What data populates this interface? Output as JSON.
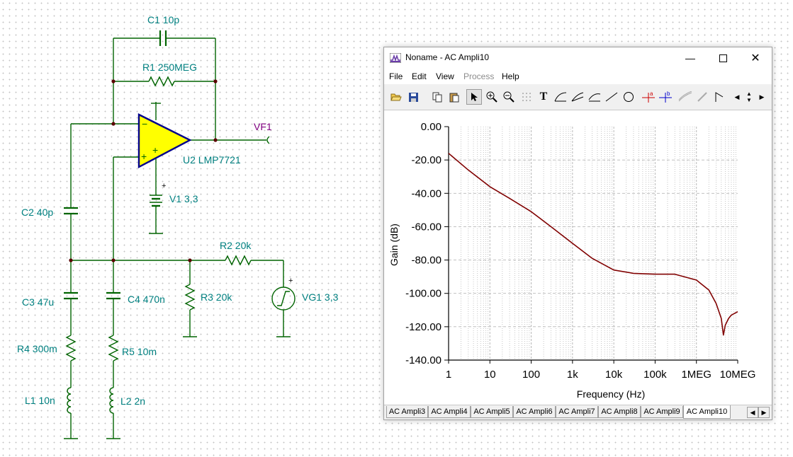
{
  "schematic": {
    "c1": "C1 10p",
    "r1": "R1 250MEG",
    "vf1": "VF1",
    "u2": "U2 LMP7721",
    "v1": "V1 3,3",
    "c2": "C2 40p",
    "r2": "R2 20k",
    "c3": "C3 47u",
    "c4": "C4 470n",
    "r3": "R3 20k",
    "vg1": "VG1 3,3",
    "r4": "R4 300m",
    "r5": "R5 10m",
    "l1": "L1 10n",
    "l2": "L2 2n",
    "wire_color": "#006400",
    "opamp_fill": "#ffff00",
    "opamp_stroke": "#00008b"
  },
  "window": {
    "title": "Noname - AC Ampli10",
    "menu": [
      {
        "label": "File"
      },
      {
        "label": "Edit"
      },
      {
        "label": "View"
      },
      {
        "label": "Process"
      },
      {
        "label": "Help"
      }
    ],
    "tabs": [
      "AC Ampli3",
      "AC Ampli4",
      "AC Ampli5",
      "AC Ampli6",
      "AC Ampli7",
      "AC Ampli8",
      "AC Ampli9",
      "AC Ampli10"
    ],
    "active_tab": "AC Ampli10",
    "icons": [
      "open-icon",
      "save-icon",
      "copy-icon",
      "paste-icon",
      "pointer-icon",
      "zoom-in-icon",
      "zoom-out-icon",
      "grid-icon",
      "text-icon",
      "curve-icon",
      "line-icon",
      "circle-icon",
      "cursor-a-icon",
      "cursor-b-icon"
    ]
  },
  "chart_data": {
    "type": "line",
    "xlabel": "Frequency (Hz)",
    "ylabel": "Gain (dB)",
    "x_scale": "log",
    "xlim": [
      1,
      10000000
    ],
    "ylim": [
      -140,
      0
    ],
    "x_ticks": [
      "1",
      "10",
      "100",
      "1k",
      "10k",
      "100k",
      "1MEG",
      "10MEG"
    ],
    "y_ticks": [
      "0.00",
      "-20.00",
      "-40.00",
      "-60.00",
      "-80.00",
      "-100.00",
      "-120.00",
      "-140.00"
    ],
    "grid": true,
    "line_color": "#800000",
    "series": [
      {
        "x": [
          1,
          3,
          10,
          30,
          100,
          300,
          1000,
          3000,
          10000,
          30000,
          100000,
          300000,
          1000000,
          2000000,
          3000000,
          4000000,
          4500000,
          5000000,
          6000000,
          7000000,
          10000000
        ],
        "y": [
          -16,
          -26,
          -36,
          -43,
          -51,
          -60,
          -70,
          -79,
          -86,
          -88,
          -88.5,
          -88.5,
          -92,
          -98,
          -106,
          -115,
          -125,
          -119,
          -115,
          -113,
          -111
        ]
      }
    ]
  }
}
